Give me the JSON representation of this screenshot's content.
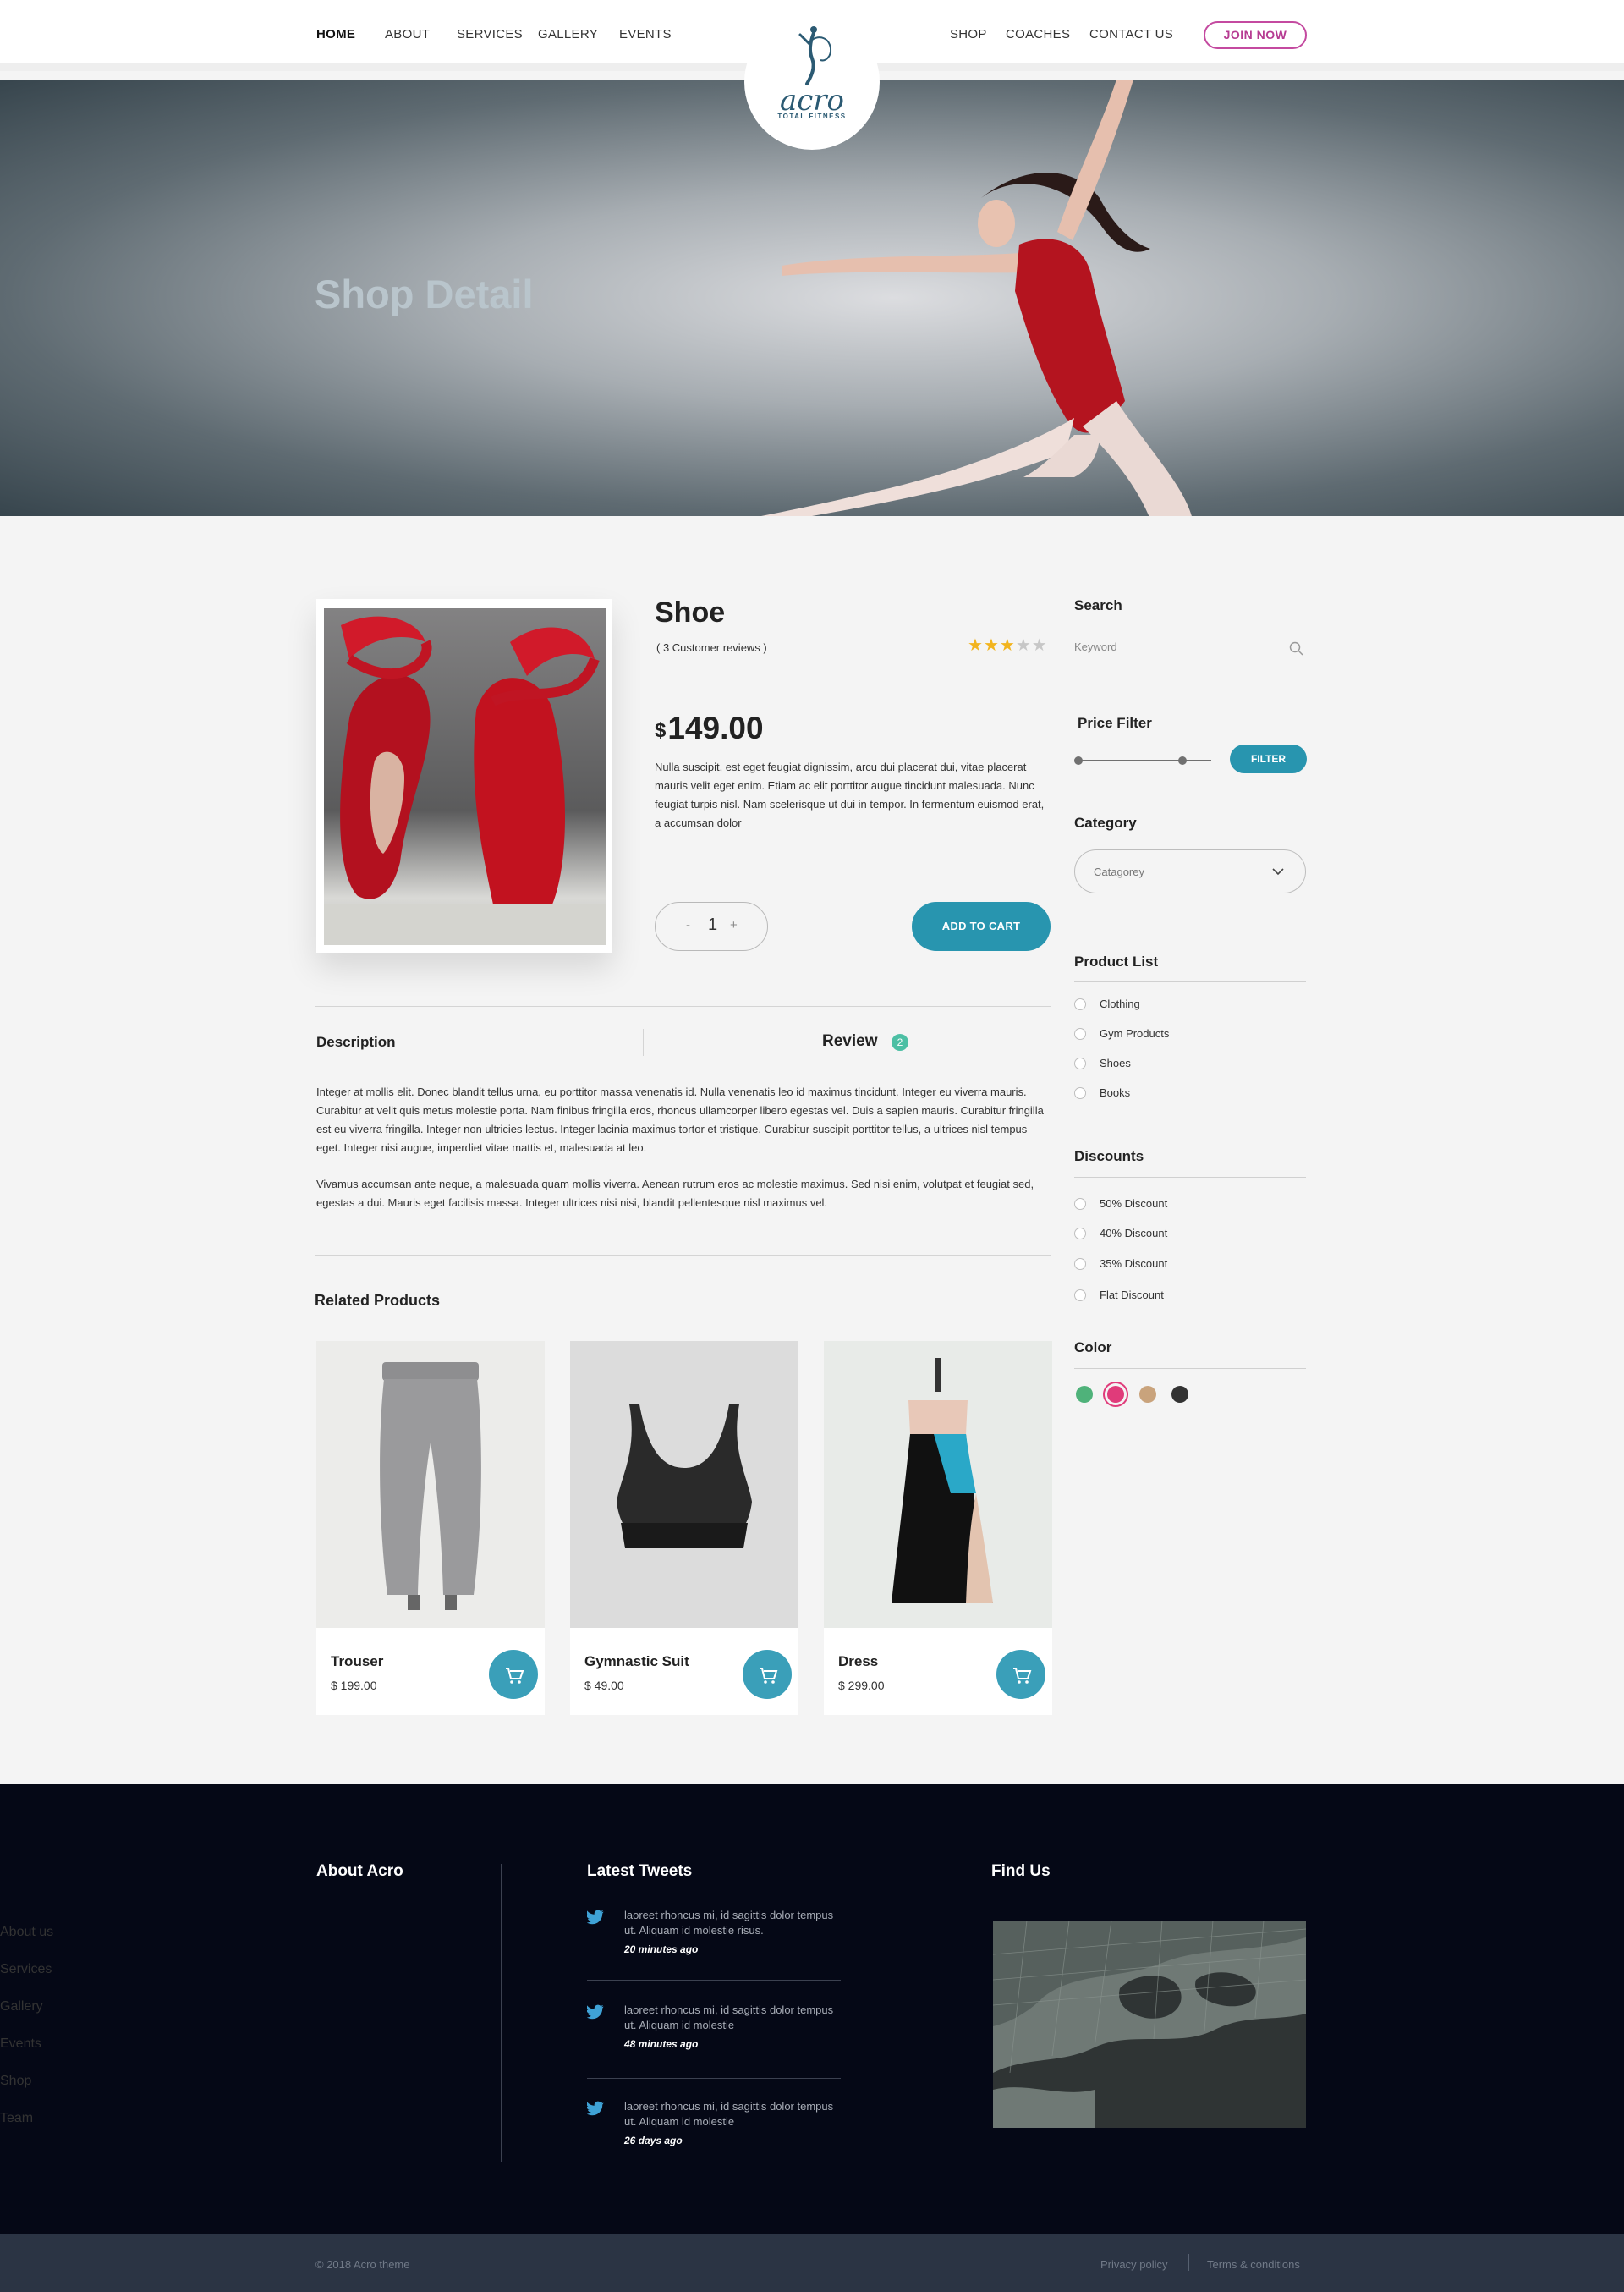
{
  "nav": {
    "items": [
      "HOME",
      "ABOUT",
      "SERVICES",
      "GALLERY",
      "EVENTS",
      "SHOP",
      "COACHES",
      "CONTACT US"
    ],
    "join": "JOIN NOW",
    "logo_name": "acro",
    "logo_sub": "TOTAL FITNESS"
  },
  "hero": {
    "title": "Shop Detail"
  },
  "product": {
    "name": "Shoe",
    "reviews": "( 3 Customer reviews )",
    "rating": 3,
    "rating_max": 5,
    "currency": "$",
    "price": "149.00",
    "description": "Nulla suscipit, est eget feugiat dignissim, arcu dui placerat dui, vitae placerat mauris velit eget enim. Etiam ac elit porttitor augue tincidunt malesuada. Nunc feugiat turpis nisl.  Nam scelerisque ut dui in tempor. In fermentum euismod erat, a accumsan dolor",
    "qty_minus": "-",
    "qty": "1",
    "qty_plus": "+",
    "add_to_cart": "ADD TO CART"
  },
  "tabs": {
    "description": "Description",
    "review": "Review",
    "review_count": "2",
    "para1": "Integer at mollis elit. Donec blandit tellus urna, eu porttitor massa venenatis id. Nulla venenatis leo id maximus tincidunt. Integer eu viverra mauris. Curabitur at velit quis metus molestie porta. Nam finibus fringilla eros, rhoncus ullamcorper libero egestas vel. Duis a sapien mauris. Curabitur fringilla est eu viverra fringilla. Integer non ultricies lectus. Integer lacinia maximus tortor et tristique. Curabitur suscipit porttitor tellus, a ultrices nisl tempus eget. Integer nisi augue, imperdiet vitae mattis et, malesuada at leo.",
    "para2": "Vivamus accumsan ante neque, a malesuada quam mollis viverra. Aenean rutrum eros ac molestie maximus. Sed nisi enim, volutpat et feugiat sed, egestas a dui. Mauris eget facilisis massa. Integer ultrices nisi nisi, blandit pellentesque nisl maximus vel."
  },
  "related": {
    "title": "Related Products",
    "items": [
      {
        "name": "Trouser",
        "price": "$ 199.00"
      },
      {
        "name": "Gymnastic Suit",
        "price": "$ 49.00"
      },
      {
        "name": "Dress",
        "price": "$ 299.00"
      }
    ]
  },
  "sidebar": {
    "search_title": "Search",
    "search_placeholder": "Keyword",
    "price_title": "Price Filter",
    "filter_button": "FILTER",
    "category_title": "Category",
    "category_value": "Catagorey",
    "product_list_title": "Product List",
    "product_list": [
      "Clothing",
      "Gym Products",
      "Shoes",
      "Books"
    ],
    "discounts_title": "Discounts",
    "discounts": [
      "50% Discount",
      "40% Discount",
      "35% Discount",
      "Flat Discount"
    ],
    "color_title": "Color",
    "colors": [
      "#4fb27a",
      "#e03b7a",
      "#c9a37c",
      "#333333"
    ]
  },
  "footer": {
    "about_title": "About Acro",
    "links": [
      "About us",
      "Services",
      "Gallery",
      "Events",
      "Shop",
      "Team"
    ],
    "tweets_title": "Latest Tweets",
    "tweets": [
      {
        "text": "laoreet rhoncus mi, id sagittis dolor tempus ut. Aliquam id molestie risus.",
        "time": "20 minutes ago"
      },
      {
        "text": "laoreet rhoncus mi, id sagittis dolor tempus ut. Aliquam id molestie",
        "time": "48 minutes ago"
      },
      {
        "text": "laoreet rhoncus mi, id sagittis dolor tempus ut. Aliquam id molestie",
        "time": "26 days ago"
      }
    ],
    "find_title": "Find Us",
    "copyright": "© 2018 Acro theme",
    "privacy": "Privacy policy",
    "terms": "Terms & conditions"
  }
}
